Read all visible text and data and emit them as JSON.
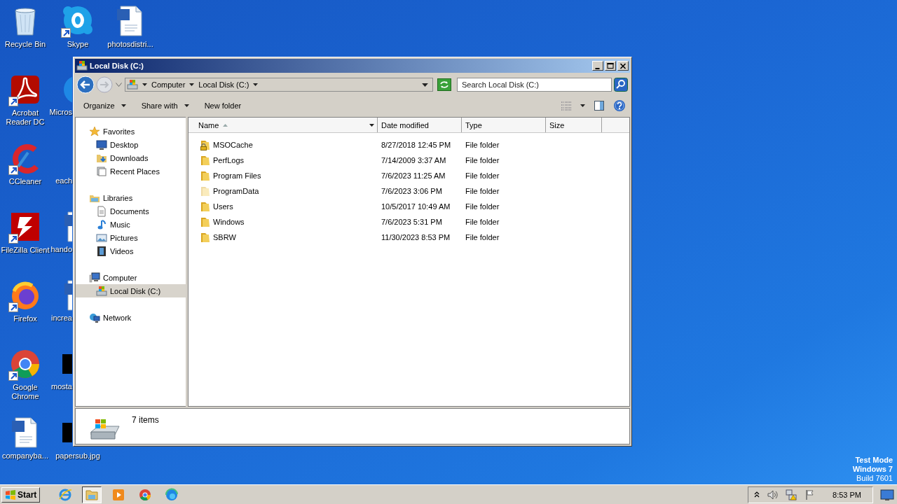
{
  "desktop": {
    "columns": [
      [
        {
          "label": "Recycle Bin",
          "kind": "recycle-bin",
          "shortcut": false,
          "covered": false
        },
        {
          "label": "Acrobat Reader DC",
          "kind": "acrobat",
          "shortcut": true,
          "covered": false
        },
        {
          "label": "CCleaner",
          "kind": "ccleaner",
          "shortcut": true,
          "covered": false
        },
        {
          "label": "FileZilla Client",
          "kind": "filezilla",
          "shortcut": true,
          "covered": false
        },
        {
          "label": "Firefox",
          "kind": "firefox",
          "shortcut": true,
          "covered": false
        },
        {
          "label": "Google Chrome",
          "kind": "chrome",
          "shortcut": true,
          "covered": false
        },
        {
          "label": "companyba...",
          "kind": "word",
          "shortcut": false,
          "covered": false
        }
      ],
      [
        {
          "label": "Skype",
          "kind": "skype",
          "shortcut": true,
          "covered": false
        },
        {
          "label": "Micros",
          "kind": "edge",
          "covered": true
        },
        {
          "label": "each",
          "kind": "blank",
          "covered": true
        },
        {
          "label": "hando",
          "kind": "word",
          "covered": true
        },
        {
          "label": "increa",
          "kind": "word",
          "covered": true
        },
        {
          "label": "mosta",
          "kind": "black",
          "covered": true
        },
        {
          "label": "papersub.jpg",
          "kind": "black",
          "covered": true
        }
      ],
      [
        {
          "label": "photosdistri...",
          "kind": "word",
          "shortcut": false,
          "covered": false
        }
      ]
    ],
    "os_notice": [
      {
        "text": "Test Mode",
        "bold": true
      },
      {
        "text": "Windows 7",
        "bold": true
      },
      {
        "text": "Build 7601",
        "bold": false
      }
    ]
  },
  "window": {
    "title": "Local Disk (C:)",
    "address": {
      "back_enabled": true,
      "forward_enabled": false,
      "breadcrumbs": [
        "Computer",
        "Local Disk (C:)"
      ]
    },
    "search": {
      "placeholder": "Search Local Disk (C:)"
    },
    "toolbar": [
      {
        "label": "Organize",
        "menu": true
      },
      {
        "label": "Share with",
        "menu": true
      },
      {
        "label": "New folder",
        "menu": false
      }
    ],
    "sidebar": {
      "groups": [
        {
          "label": "Favorites",
          "kind": "star",
          "selected": false,
          "children": [
            {
              "label": "Desktop",
              "kind": "desktop",
              "selected": false
            },
            {
              "label": "Downloads",
              "kind": "downloads",
              "selected": false
            },
            {
              "label": "Recent Places",
              "kind": "recent",
              "selected": false
            }
          ]
        },
        {
          "label": "Libraries",
          "kind": "library",
          "selected": false,
          "children": [
            {
              "label": "Documents",
              "kind": "document",
              "selected": false
            },
            {
              "label": "Music",
              "kind": "music",
              "selected": false
            },
            {
              "label": "Pictures",
              "kind": "pictures",
              "selected": false
            },
            {
              "label": "Videos",
              "kind": "videos",
              "selected": false
            }
          ]
        },
        {
          "label": "Computer",
          "kind": "computer",
          "selected": false,
          "children": [
            {
              "label": "Local Disk (C:)",
              "kind": "drive",
              "selected": true
            }
          ]
        },
        {
          "label": "Network",
          "kind": "network",
          "selected": false
        }
      ]
    },
    "table": {
      "columns": [
        {
          "label": "Name",
          "sorted": true
        },
        {
          "label": "Date modified",
          "sorted": false
        },
        {
          "label": "Type",
          "sorted": false
        },
        {
          "label": "Size",
          "sorted": false
        }
      ],
      "rows": [
        {
          "name": "MSOCache",
          "date": "8/27/2018 12:45 PM",
          "type": "File folder",
          "locked": true,
          "hidden": false
        },
        {
          "name": "PerfLogs",
          "date": "7/14/2009 3:37 AM",
          "type": "File folder",
          "locked": false,
          "hidden": false
        },
        {
          "name": "Program Files",
          "date": "7/6/2023 11:25 AM",
          "type": "File folder",
          "locked": false,
          "hidden": false
        },
        {
          "name": "ProgramData",
          "date": "7/6/2023 3:06 PM",
          "type": "File folder",
          "locked": false,
          "hidden": true
        },
        {
          "name": "Users",
          "date": "10/5/2017 10:49 AM",
          "type": "File folder",
          "locked": false,
          "hidden": false
        },
        {
          "name": "Windows",
          "date": "7/6/2023 5:31 PM",
          "type": "File folder",
          "locked": false,
          "hidden": false
        },
        {
          "name": "SBRW",
          "date": "11/30/2023 8:53 PM",
          "type": "File folder",
          "locked": false,
          "hidden": false
        }
      ]
    },
    "status_bar": {
      "text": "7 items"
    }
  },
  "taskbar": {
    "start": "Start",
    "items": [
      {
        "kind": "ie",
        "selected": false
      },
      {
        "kind": "explorer",
        "selected": true
      },
      {
        "kind": "media",
        "selected": false
      },
      {
        "kind": "chrome",
        "selected": false
      },
      {
        "kind": "edge",
        "selected": false
      }
    ],
    "clock": "8:53 PM"
  }
}
